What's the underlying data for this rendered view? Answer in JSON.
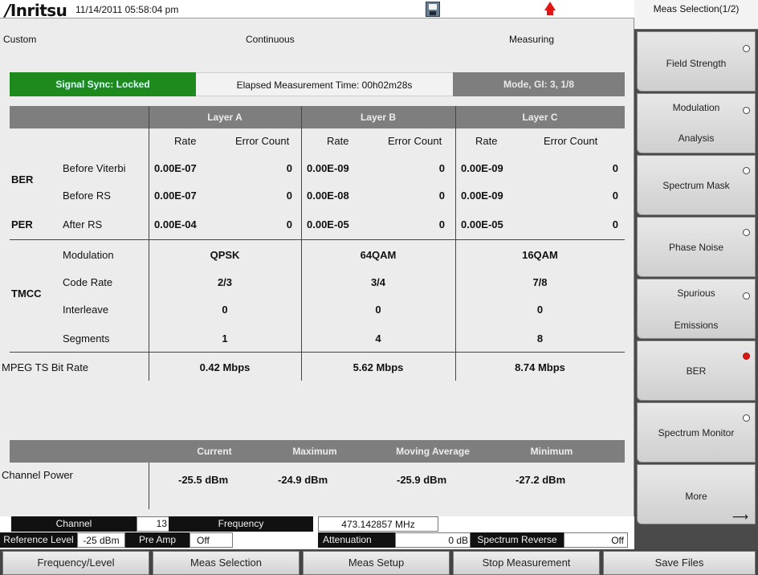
{
  "header": {
    "brand": "/inritsu",
    "timestamp": "11/14/2011 05:58:04 pm",
    "mode_left": "Custom",
    "mode_center": "Continuous",
    "mode_right": "Measuring"
  },
  "summary": {
    "sync": "Signal Sync: Locked",
    "elapsed": "Elapsed Measurement Time:  00h02m28s",
    "mode": "Mode, GI: 3, 1/8"
  },
  "table": {
    "layers": [
      "Layer A",
      "Layer B",
      "Layer C"
    ],
    "rate_header": "Rate",
    "error_header": "Error Count",
    "ber_label": "BER",
    "per_label": "PER",
    "rows": [
      {
        "label": "Before Viterbi",
        "a_rate": "0.00E-07",
        "a_err": "0",
        "b_rate": "0.00E-09",
        "b_err": "0",
        "c_rate": "0.00E-09",
        "c_err": "0"
      },
      {
        "label": "Before RS",
        "a_rate": "0.00E-07",
        "a_err": "0",
        "b_rate": "0.00E-08",
        "b_err": "0",
        "c_rate": "0.00E-09",
        "c_err": "0"
      },
      {
        "label": "After RS",
        "a_rate": "0.00E-04",
        "a_err": "0",
        "b_rate": "0.00E-05",
        "b_err": "0",
        "c_rate": "0.00E-05",
        "c_err": "0"
      }
    ],
    "tmcc_label": "TMCC",
    "tmcc": [
      {
        "label": "Modulation",
        "a": "QPSK",
        "b": "64QAM",
        "c": "16QAM"
      },
      {
        "label": "Code Rate",
        "a": "2/3",
        "b": "3/4",
        "c": "7/8"
      },
      {
        "label": "Interleave",
        "a": "0",
        "b": "0",
        "c": "0"
      },
      {
        "label": "Segments",
        "a": "1",
        "b": "4",
        "c": "8"
      }
    ],
    "mpeg_label": "MPEG TS Bit Rate",
    "mpeg": {
      "a": "0.42 Mbps",
      "b": "5.62 Mbps",
      "c": "8.74 Mbps"
    }
  },
  "power": {
    "headers": [
      "Current",
      "Maximum",
      "Moving Average",
      "Minimum"
    ],
    "label": "Channel Power",
    "current": "-25.5 dBm",
    "maximum": "-24.9 dBm",
    "moving_average": "-25.9 dBm",
    "minimum": "-27.2 dBm"
  },
  "info": {
    "channel_label": "Channel",
    "channel_value": "13",
    "frequency_label": "Frequency",
    "frequency_value": "473.142857 MHz",
    "ref_label": "Reference Level",
    "ref_value": "-25 dBm",
    "preamp_label": "Pre Amp",
    "preamp_value": "Off",
    "atten_label": "Attenuation",
    "atten_value": "0 dB",
    "spec_rev_label": "Spectrum Reverse",
    "spec_rev_value": "Off"
  },
  "softkeys": {
    "title": "Meas Selection(1/2)",
    "field_strength": "Field Strength",
    "modulation_line1": "Modulation",
    "modulation_line2": "Analysis",
    "spectrum_mask": "Spectrum Mask",
    "phase_noise": "Phase Noise",
    "spurious_line1": "Spurious",
    "spurious_line2": "Emissions",
    "ber": "BER",
    "spectrum_monitor": "Spectrum Monitor",
    "more": "More"
  },
  "function_keys": [
    "Frequency/Level",
    "Meas Selection",
    "Meas Setup",
    "Stop Measurement",
    "Save Files"
  ],
  "colors": {
    "sync_ok": "#1e8a1e",
    "header_gray": "#7e7e7e",
    "active_radio": "#e01515"
  }
}
